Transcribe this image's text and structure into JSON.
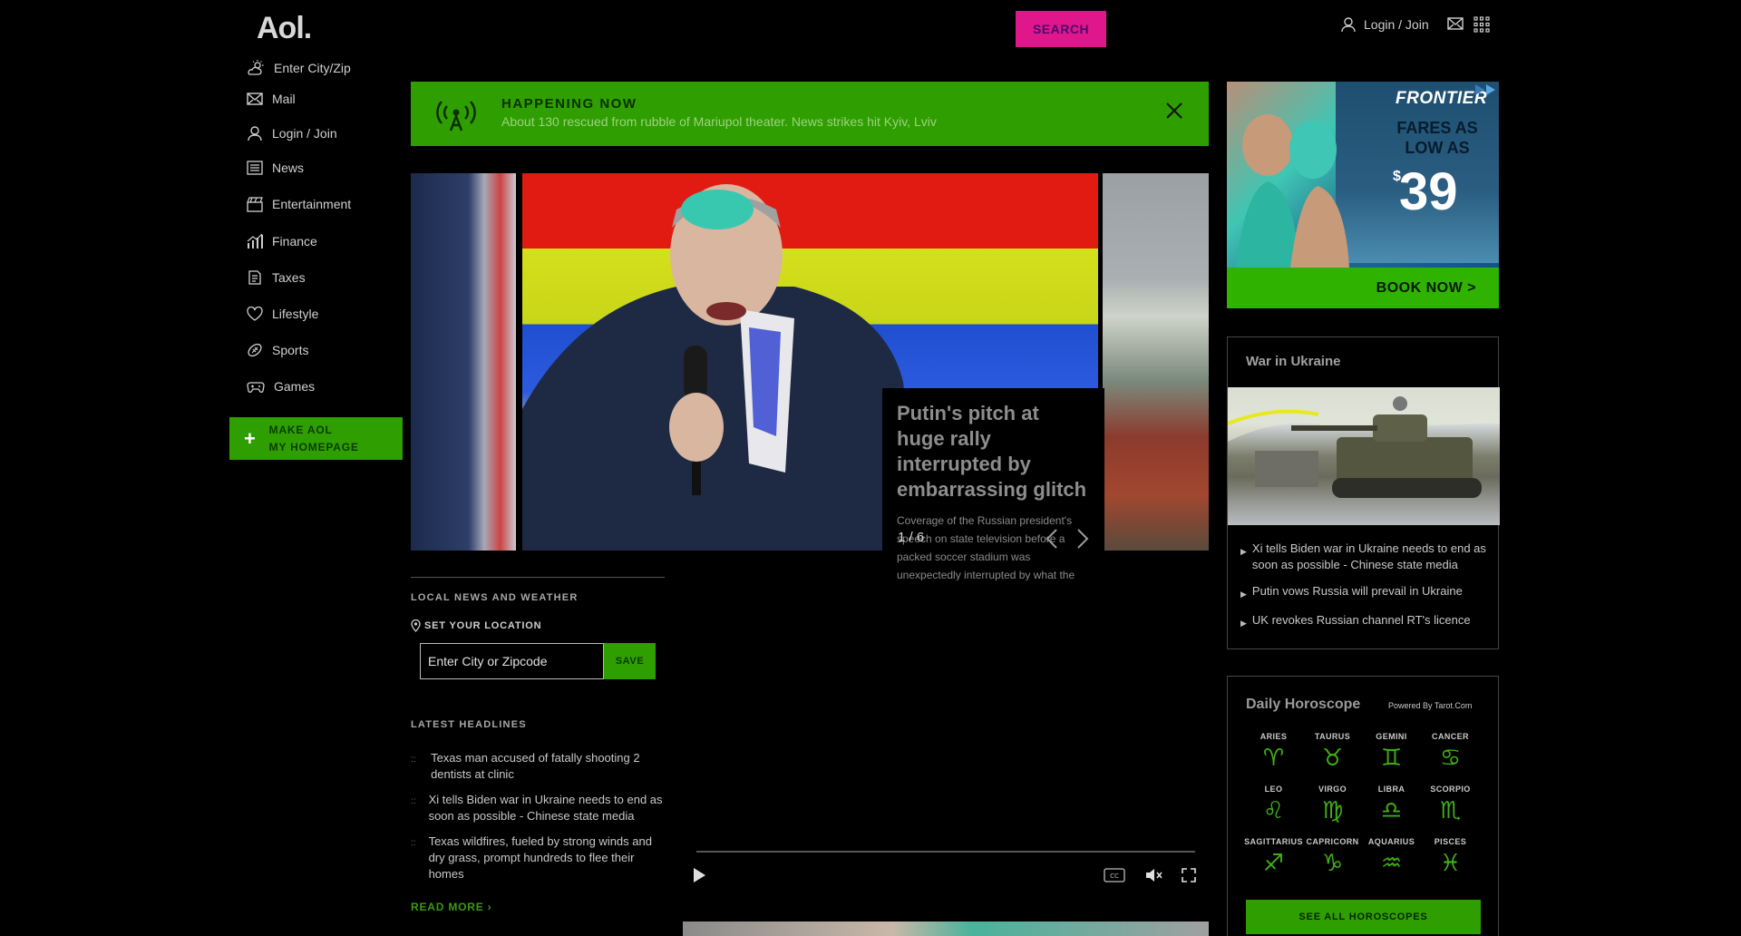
{
  "header": {
    "logo": "Aol.",
    "search_label": "SEARCH",
    "login_label": "Login / Join"
  },
  "sidebar": {
    "items": [
      {
        "label": "Enter City/Zip",
        "icon": "weather-icon"
      },
      {
        "label": "Mail",
        "icon": "mail-icon"
      },
      {
        "label": "Login / Join",
        "icon": "user-icon"
      },
      {
        "label": "News",
        "icon": "news-icon"
      },
      {
        "label": "Entertainment",
        "icon": "clapper-icon"
      },
      {
        "label": "Finance",
        "icon": "chart-icon"
      },
      {
        "label": "Taxes",
        "icon": "document-icon"
      },
      {
        "label": "Lifestyle",
        "icon": "heart-icon"
      },
      {
        "label": "Sports",
        "icon": "football-icon"
      },
      {
        "label": "Games",
        "icon": "gamepad-icon"
      }
    ],
    "make_aol_line1": "MAKE AOL",
    "make_aol_line2": "MY HOMEPAGE"
  },
  "banner": {
    "title": "HAPPENING NOW",
    "text": "About 130 rescued from rubble of Mariupol theater. News strikes hit Kyiv, Lviv"
  },
  "carousel": {
    "title": "Putin's pitch at huge rally interrupted by embarrassing glitch",
    "description": "Coverage of the Russian president's speech on state television before a packed soccer stadium was unexpectedly interrupted by what the Kremlin",
    "counter": "1 / 6"
  },
  "local": {
    "section_label": "LOCAL NEWS AND WEATHER",
    "set_location": "SET YOUR LOCATION",
    "input_placeholder": "Enter City or Zipcode",
    "save_label": "SAVE"
  },
  "headlines": {
    "section_label": "LATEST HEADLINES",
    "items": [
      "Texas man accused of fatally shooting 2 dentists at clinic",
      "Xi tells Biden war in Ukraine needs to end as soon as possible - Chinese state media",
      "Texas wildfires, fueled by strong winds and dry grass, prompt hundreds to flee their homes"
    ],
    "read_more": "READ MORE ›"
  },
  "ad": {
    "brand": "FRONTIER",
    "fares_line1": "FARES AS",
    "fares_line2": "LOW AS",
    "dollar": "$",
    "price": "39",
    "cta": "BOOK NOW >"
  },
  "war": {
    "title": "War in Ukraine",
    "items": [
      "Xi tells Biden war in Ukraine needs to end as soon as possible - Chinese state media",
      "Putin vows Russia will prevail in Ukraine",
      "UK revokes Russian channel RT's licence"
    ]
  },
  "horoscope": {
    "title": "Daily Horoscope",
    "powered_by": "Powered By Tarot.Com",
    "signs": [
      {
        "name": "ARIES",
        "glyph": "♈"
      },
      {
        "name": "TAURUS",
        "glyph": "♉"
      },
      {
        "name": "GEMINI",
        "glyph": "♊"
      },
      {
        "name": "CANCER",
        "glyph": "♋"
      },
      {
        "name": "LEO",
        "glyph": "♌"
      },
      {
        "name": "VIRGO",
        "glyph": "♍"
      },
      {
        "name": "LIBRA",
        "glyph": "♎"
      },
      {
        "name": "SCORPIO",
        "glyph": "♏"
      },
      {
        "name": "SAGITTARIUS",
        "glyph": "♐"
      },
      {
        "name": "CAPRICORN",
        "glyph": "♑"
      },
      {
        "name": "AQUARIUS",
        "glyph": "♒"
      },
      {
        "name": "PISCES",
        "glyph": "♓"
      }
    ],
    "see_all": "SEE ALL HOROSCOPES"
  },
  "colors": {
    "accent_green": "#2f9e00",
    "search_pink": "#e0168c",
    "background": "#000000"
  }
}
